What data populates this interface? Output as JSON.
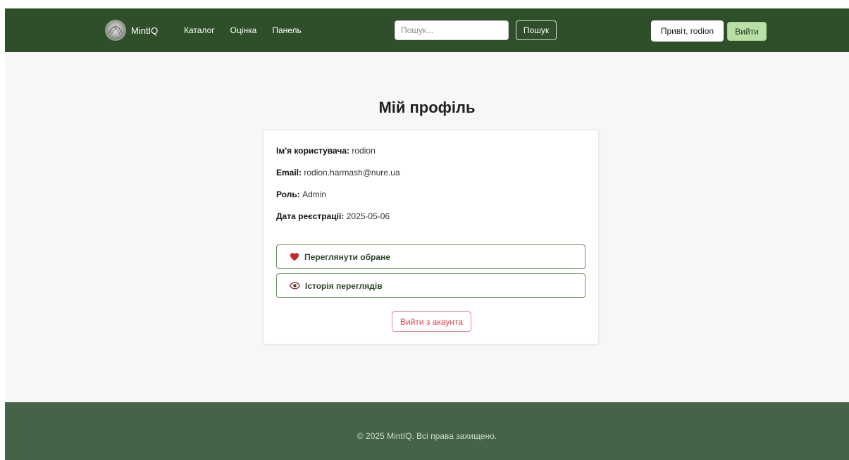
{
  "navbar": {
    "brand": "MintIQ",
    "links": [
      "Каталог",
      "Оцінка",
      "Панель"
    ],
    "search_placeholder": "Пошук...",
    "search_button": "Пошук",
    "greeting": "Привіт, rodion",
    "logout": "Вийти"
  },
  "profile": {
    "title": "Мій профіль",
    "username_label": "Ім'я користувача:",
    "username": "rodion",
    "email_label": "Email:",
    "email": "rodion.harmash@nure.ua",
    "role_label": "Роль:",
    "role": "Admin",
    "registered_label": "Дата реєстрації:",
    "registered": "2025-05-06",
    "favorites_button": "Переглянути обране",
    "history_button": "Історія переглядів",
    "logout_account_button": "Вийти з акаунта"
  },
  "footer": {
    "text": "© 2025 MintIQ. Всі права захищено."
  },
  "colors": {
    "navbar": "#2f4f2a",
    "footer": "#456347",
    "accent_button": "#b9dea6",
    "danger": "#d9434f",
    "heart": "#c62828"
  },
  "icons": {
    "favorites": "heart-icon",
    "history": "eye-icon"
  }
}
